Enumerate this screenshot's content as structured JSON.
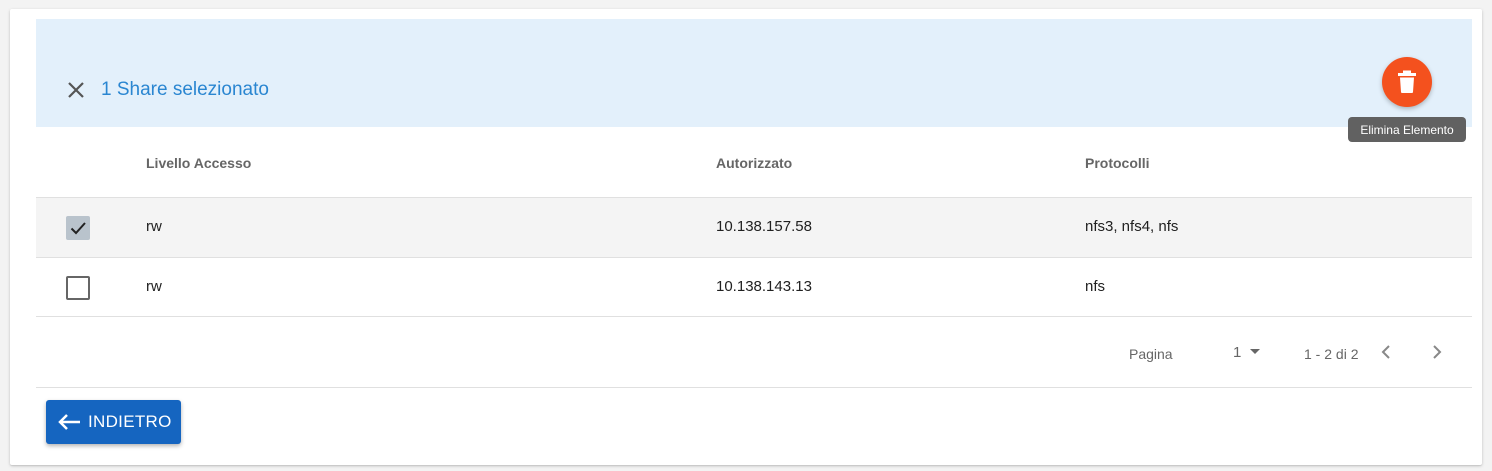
{
  "selection": {
    "text": "1 Share selezionato"
  },
  "actions": {
    "delete_tooltip": "Elimina Elemento"
  },
  "table": {
    "columns": [
      "Livello Accesso",
      "Autorizzato",
      "Protocolli"
    ],
    "rows": [
      {
        "selected": true,
        "access_level": "rw",
        "authorized": "10.138.157.58",
        "protocols": "nfs3, nfs4, nfs"
      },
      {
        "selected": false,
        "access_level": "rw",
        "authorized": "10.138.143.13",
        "protocols": "nfs"
      }
    ]
  },
  "pagination": {
    "page_label": "Pagina",
    "page_value": "1",
    "range_text": "1 - 2 di 2"
  },
  "footer": {
    "back_label": "INDIETRO"
  },
  "icons": {
    "close": "close-icon",
    "delete": "trash-icon",
    "check": "check-icon",
    "dropdown": "triangle-down-icon",
    "prev": "chevron-left-icon",
    "next": "chevron-right-icon",
    "back": "arrow-left-icon"
  },
  "colors": {
    "accent_blue": "#2a86d1",
    "selection_bg": "#e3f0fb",
    "delete_fab": "#f4511e",
    "primary_button": "#1565c0"
  }
}
